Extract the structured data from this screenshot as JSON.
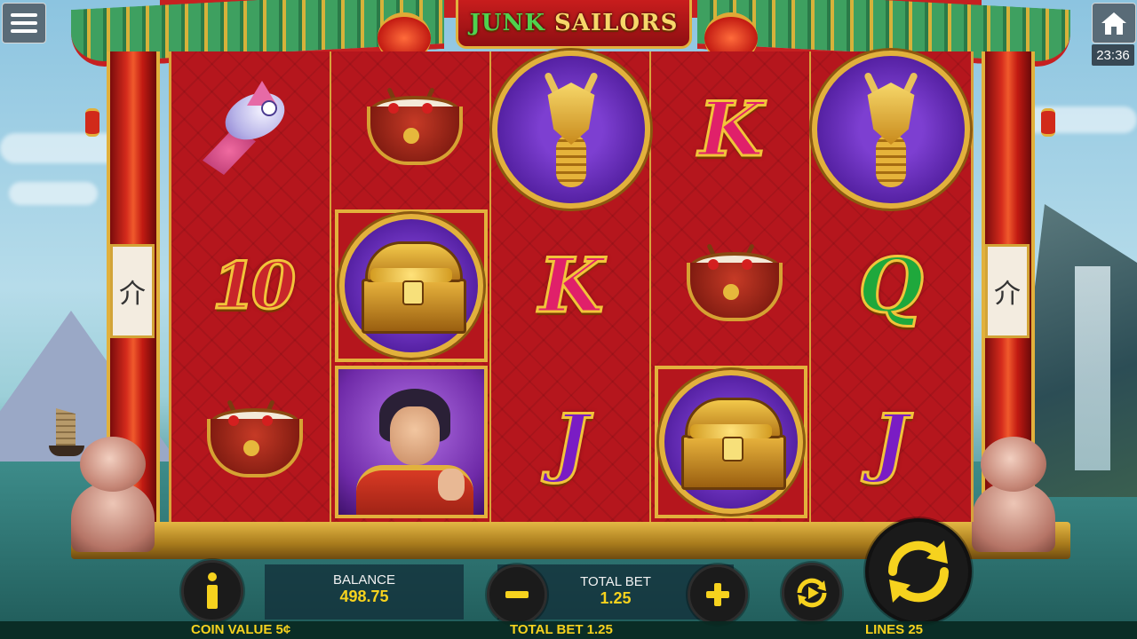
{
  "game": {
    "title_part1": "JUNK",
    "title_part2": "SAILORS"
  },
  "clock": "23:36",
  "icons": {
    "menu": "hamburger-menu-icon",
    "home": "home-icon",
    "info": "info-icon",
    "minus": "minus-icon",
    "plus": "plus-icon",
    "autoplay": "autoplay-icon",
    "spin": "spin-icon"
  },
  "reels": [
    [
      "fish",
      "10",
      "drum"
    ],
    [
      "drum",
      "treasure-chest",
      "sailor-hero"
    ],
    [
      "dragon",
      "K",
      "J"
    ],
    [
      "K",
      "drum",
      "treasure-chest"
    ],
    [
      "dragon",
      "Q",
      "J"
    ]
  ],
  "symbols": {
    "ten": "10",
    "k": "K",
    "q": "Q",
    "j": "J"
  },
  "pillar_glyph": "介",
  "balance": {
    "label": "BALANCE",
    "value": "498.75"
  },
  "total_bet": {
    "label": "TOTAL BET",
    "value": "1.25"
  },
  "bottom_bar": {
    "coin_value": "COIN VALUE 5¢",
    "total_bet": "TOTAL BET 1.25",
    "lines": "LINES 25"
  },
  "colors": {
    "accent_yellow": "#f6d21e",
    "reel_red": "#b5161d",
    "gold": "#e2b13c"
  }
}
